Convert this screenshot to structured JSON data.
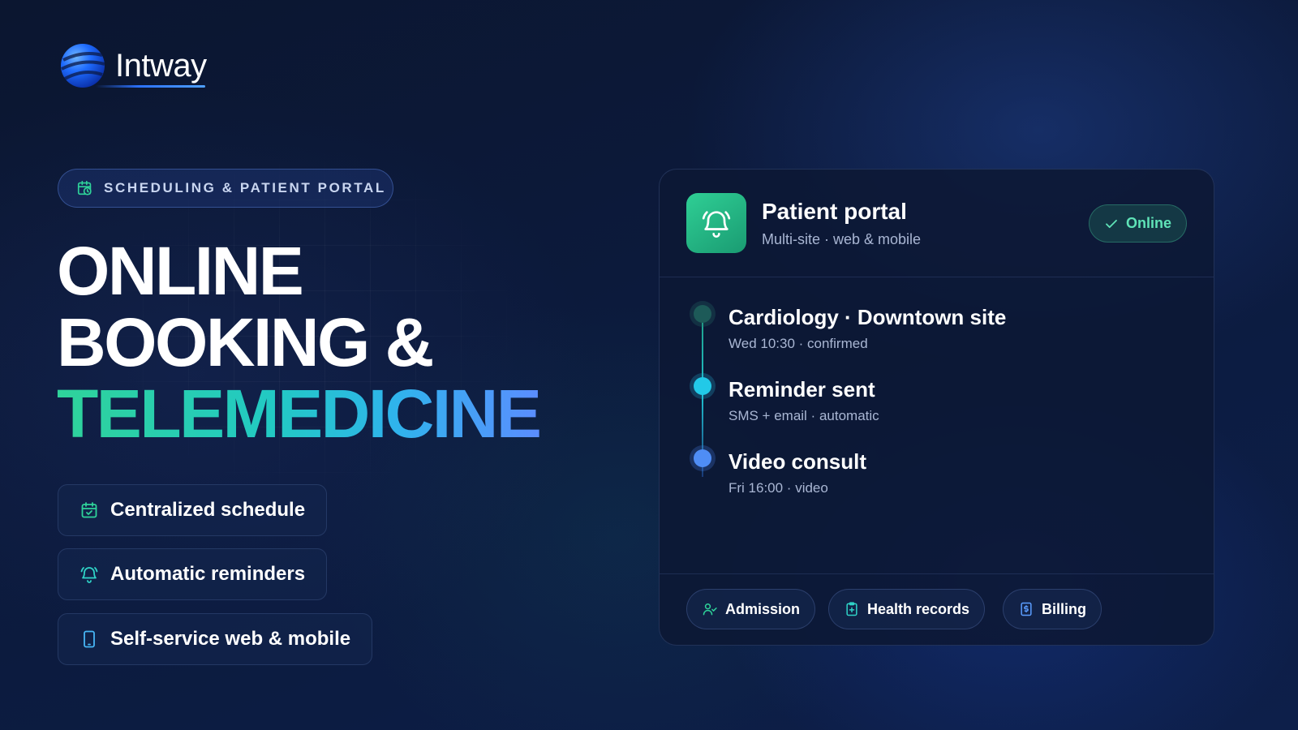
{
  "brand": {
    "name": "Intway",
    "logo_icon": "globe-logo-icon"
  },
  "eyebrow": {
    "label": "SCHEDULING & PATIENT PORTAL",
    "icon": "calendar-clock-icon"
  },
  "headline": {
    "line1": "ONLINE",
    "line2": "BOOKING &",
    "line3": "TELEMEDICINE"
  },
  "features": [
    {
      "label": "Centralized schedule",
      "icon": "calendar-check-icon"
    },
    {
      "label": "Automatic reminders",
      "icon": "bell-icon"
    },
    {
      "label": "Self-service web & mobile",
      "icon": "smartphone-icon"
    }
  ],
  "portal": {
    "title": "Patient portal",
    "subtitle": "Multi-site · web & mobile",
    "status": "Online",
    "timeline": [
      {
        "title": "Cardiology · Downtown site",
        "detail": "Wed 10:30 · confirmed"
      },
      {
        "title": "Reminder sent",
        "detail": "SMS + email · automatic"
      },
      {
        "title": "Video consult",
        "detail": "Fri 16:00 · video"
      }
    ],
    "actions": [
      {
        "label": "Admission",
        "icon": "user-check-icon"
      },
      {
        "label": "Health records",
        "icon": "clipboard-plus-icon"
      },
      {
        "label": "Billing",
        "icon": "invoice-dollar-icon"
      }
    ]
  },
  "colors": {
    "background": "#0c1a3c",
    "accent_green": "#2fd39a",
    "accent_cyan": "#22c9e0",
    "accent_blue": "#5b8dff",
    "status_green": "#5fe3b7"
  }
}
